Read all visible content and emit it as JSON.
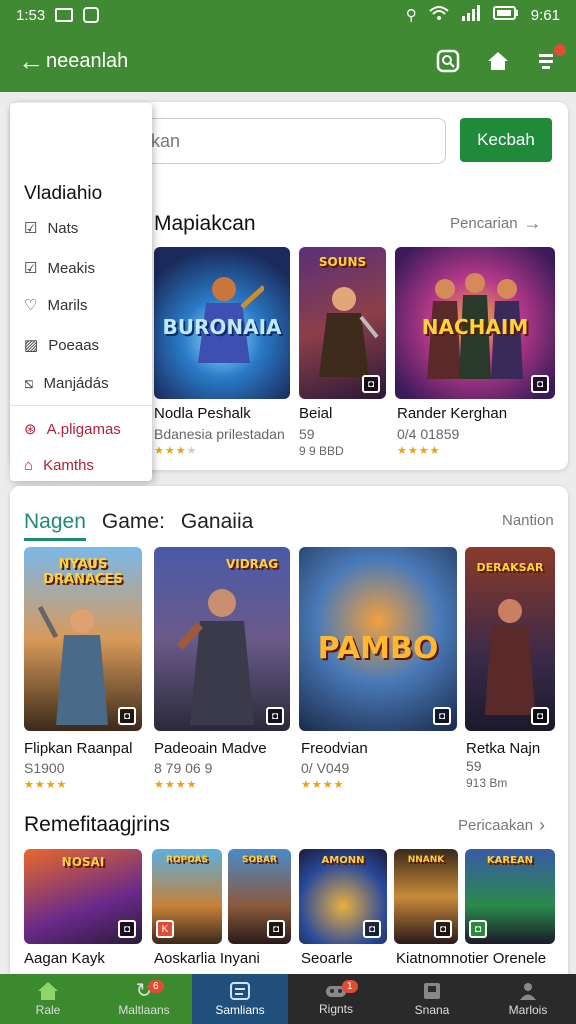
{
  "status": {
    "time": "1:53",
    "clock": "9:61"
  },
  "appbar": {
    "title": "neeanlah"
  },
  "search": {
    "placeholder": "Blensgrakkan",
    "button": "Kecbah"
  },
  "menu": {
    "title": "Vladiahio",
    "items": [
      {
        "label": "Nats",
        "icon": "check-badge-icon"
      },
      {
        "label": "Meakis",
        "icon": "checkbox-icon"
      },
      {
        "label": "Marils",
        "icon": "heart-icon"
      },
      {
        "label": "Poeaas",
        "icon": "image-icon"
      },
      {
        "label": "Manjádás",
        "icon": "slash-box-icon"
      },
      {
        "label": "A.pligamas",
        "icon": "compass-icon"
      },
      {
        "label": "Kamths",
        "icon": "home-icon"
      }
    ]
  },
  "featured": {
    "title": "Mapiakcan",
    "more": "Pencarian",
    "games": [
      {
        "name": "Nodla Peshalk",
        "sub": "Bdanesia prilestadan",
        "logo": "BURONAIA",
        "rating": 3
      },
      {
        "name": "Beial",
        "sub": "59",
        "sub2": "9 9 BBD",
        "logo": "SOUNS",
        "rating": 0
      },
      {
        "name": "Rander Kerghan",
        "sub": "0/4 01859",
        "logo": "NACHAIM",
        "rating": 4
      }
    ]
  },
  "section2": {
    "tabs": [
      "Nagen",
      "Game:",
      "Ganaiia"
    ],
    "more": "Nantion",
    "games": [
      {
        "name": "Flipkan Raanpal",
        "sub": "S1900",
        "logo": "NYAUS DRANACES",
        "rating": 4
      },
      {
        "name": "Padeoain Madve",
        "sub": "8 79 06 9",
        "logo": "VIDRAG",
        "rating": 4
      },
      {
        "name": "Freodvian",
        "sub": "0/ V049",
        "logo": "PAMBO",
        "rating": 4
      },
      {
        "name": "Retka Najn",
        "sub": "59",
        "sub2": "913 Bm",
        "logo": "DERAKSAR",
        "rating": 0
      }
    ]
  },
  "section3": {
    "title": "Remefitaagjrins",
    "more": "Pericaakan",
    "games": [
      {
        "name": "Aagan Kayk",
        "logo": "NOSAI"
      },
      {
        "name": "Aoskarlia Inyani",
        "logo": "ROPOAS"
      },
      {
        "name": "",
        "logo": "SOBAR"
      },
      {
        "name": "Seoarle",
        "logo": "AMONN"
      },
      {
        "name": "Kiatnomnotier Orenele",
        "logo": "NNANK"
      },
      {
        "name": "",
        "logo": "KAREAN"
      }
    ]
  },
  "bottom_nav": [
    {
      "label": "Rale",
      "icon": "home-icon"
    },
    {
      "label": "Maltlaans",
      "icon": "refresh-icon",
      "badge": "6"
    },
    {
      "label": "Samlians",
      "icon": "apps-icon"
    },
    {
      "label": "Rignts",
      "icon": "controller-icon",
      "badge": "1"
    },
    {
      "label": "Snana",
      "icon": "square-icon"
    },
    {
      "label": "Marlois",
      "icon": "person-icon"
    }
  ],
  "colors": {
    "primary": "#3f8a33",
    "button": "#1f8a3a",
    "tab_active": "#1d8a7a",
    "star": "#e4a414"
  }
}
